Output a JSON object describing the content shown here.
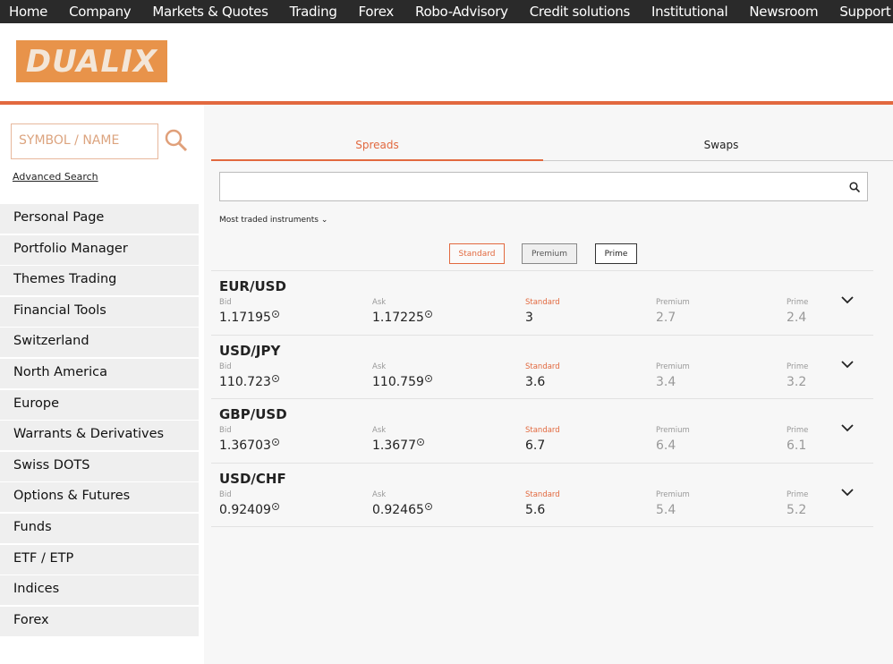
{
  "nav": [
    "Home",
    "Company",
    "Markets & Quotes",
    "Trading",
    "Forex",
    "Robo-Advisory",
    "Credit solutions",
    "Institutional",
    "Newsroom",
    "Support"
  ],
  "logo": "DUALIX",
  "sidebar": {
    "search_placeholder": "SYMBOL / NAME",
    "advanced": "Advanced Search",
    "items": [
      "Personal Page",
      "Portfolio Manager",
      "Themes Trading",
      "Financial Tools",
      "Switzerland",
      "North America",
      "Europe",
      "Warrants & Derivatives",
      "Swiss DOTS",
      "Options & Futures",
      "Funds",
      "ETF / ETP",
      "Indices",
      "Forex"
    ]
  },
  "tabs": {
    "spreads": "Spreads",
    "swaps": "Swaps"
  },
  "filter": "Most traded instruments",
  "buttons": {
    "standard": "Standard",
    "premium": "Premium",
    "prime": "Prime"
  },
  "labels": {
    "bid": "Bid",
    "ask": "Ask",
    "standard": "Standard",
    "premium": "Premium",
    "prime": "Prime"
  },
  "rows": [
    {
      "pair": "EUR/USD",
      "bid": "1.17195",
      "ask": "1.17225",
      "standard": "3",
      "premium": "2.7",
      "prime": "2.4"
    },
    {
      "pair": "USD/JPY",
      "bid": "110.723",
      "ask": "110.759",
      "standard": "3.6",
      "premium": "3.4",
      "prime": "3.2"
    },
    {
      "pair": "GBP/USD",
      "bid": "1.36703",
      "ask": "1.3677",
      "standard": "6.7",
      "premium": "6.4",
      "prime": "6.1"
    },
    {
      "pair": "USD/CHF",
      "bid": "0.92409",
      "ask": "0.92465",
      "standard": "5.6",
      "premium": "5.4",
      "prime": "5.2"
    }
  ],
  "colors": {
    "accent": "#e2693f",
    "nav": "#2a2a2a"
  }
}
